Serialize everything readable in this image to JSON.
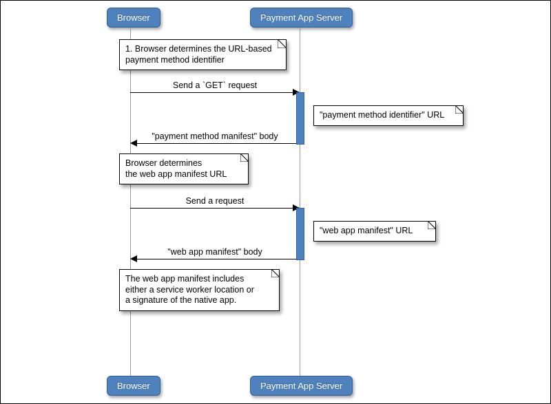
{
  "participants": {
    "browser": "Browser",
    "server": "Payment App Server"
  },
  "messages": {
    "m1": "Send a `GET` request",
    "m2": "\"payment method manifest\" body",
    "m3": "Send a request",
    "m4": "\"web app manifest\" body"
  },
  "notes": {
    "n1_l1": "1. Browser determines the URL-based",
    "n1_l2": "payment method identifier",
    "n2": "\"payment method identifier\" URL",
    "n3_l1": "Browser determines",
    "n3_l2": "the web app manifest URL",
    "n4": "\"web app manifest\" URL",
    "n5_l1": "The web app manifest includes",
    "n5_l2": "either a service worker location or",
    "n5_l3": "a signature of the native app."
  }
}
